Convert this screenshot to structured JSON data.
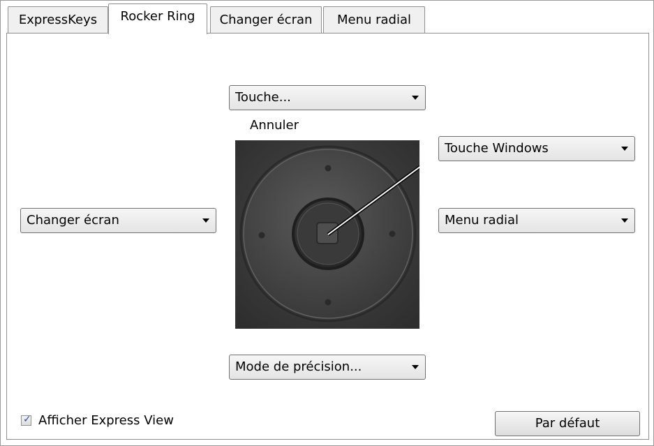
{
  "tabs": [
    {
      "label": "ExpressKeys",
      "active": false
    },
    {
      "label": "Rocker Ring",
      "active": true
    },
    {
      "label": "Changer écran",
      "active": false
    },
    {
      "label": "Menu radial",
      "active": false
    }
  ],
  "rocker": {
    "top": {
      "value": "Touche..."
    },
    "top_description": "Annuler",
    "center": {
      "value": "Touche Windows"
    },
    "left": {
      "value": "Changer écran"
    },
    "right": {
      "value": "Menu radial"
    },
    "bottom": {
      "value": "Mode de précision..."
    }
  },
  "footer": {
    "show_express_view_label": "Afficher Express View",
    "show_express_view_checked": true,
    "default_button_label": "Par défaut"
  },
  "icons": {
    "dropdown_arrow": "chevron-down-icon",
    "checkbox_mark": "checkmark-icon"
  },
  "colors": {
    "device_dark": "#3c3c3c",
    "device_ring": "#4a4a4a",
    "pointer_line": "#ffffff",
    "check": "#2a4d9b"
  }
}
